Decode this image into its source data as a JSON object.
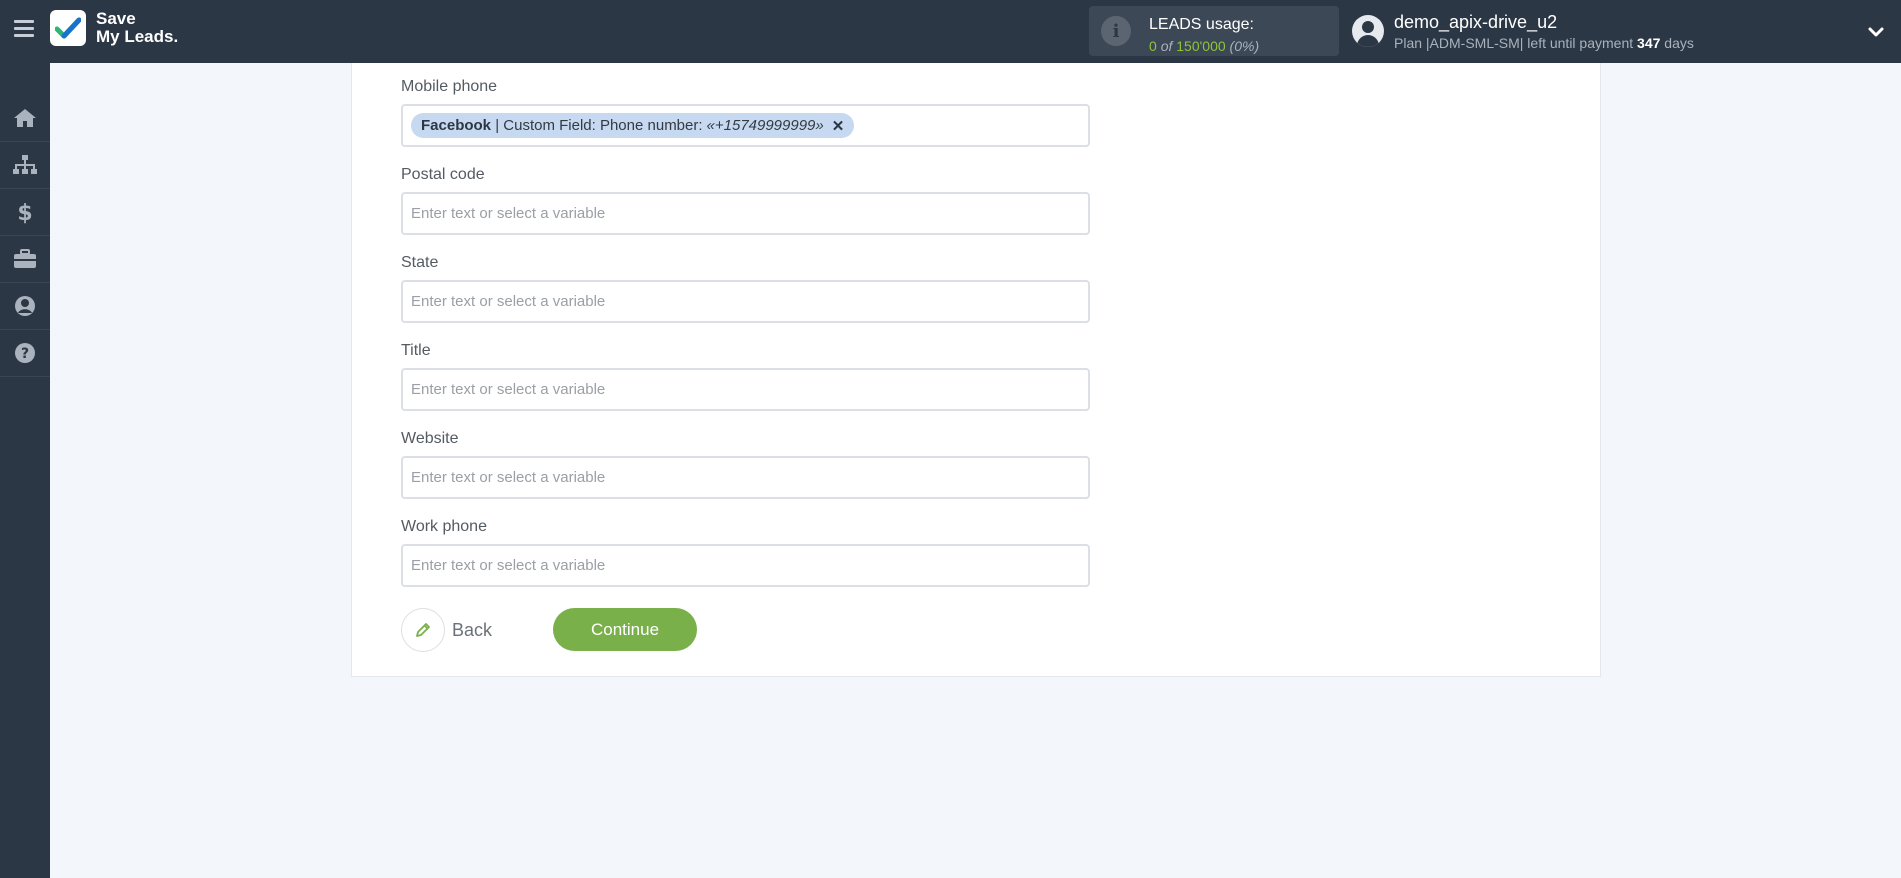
{
  "header": {
    "logo_line1": "Save",
    "logo_line2": "My Leads.",
    "usage": {
      "title": "LEADS usage:",
      "used": "0",
      "of": "of",
      "total": "150'000",
      "percent": "(0%)"
    },
    "user": {
      "name": "demo_apix-drive_u2",
      "plan_prefix": "Plan |ADM-SML-SM| left until payment",
      "days": "347",
      "days_suffix": "days"
    }
  },
  "sidebar": {
    "items": [
      {
        "icon": "home-icon"
      },
      {
        "icon": "sitemap-icon"
      },
      {
        "icon": "dollar-icon"
      },
      {
        "icon": "briefcase-icon"
      },
      {
        "icon": "user-circle-icon"
      },
      {
        "icon": "question-circle-icon"
      }
    ]
  },
  "form": {
    "mobile_phone": {
      "label": "Mobile phone",
      "tag_source": "Facebook",
      "tag_field": "| Custom Field: Phone number:",
      "tag_value": "«+15749999999»"
    },
    "postal_code": {
      "label": "Postal code",
      "placeholder": "Enter text or select a variable"
    },
    "state": {
      "label": "State",
      "placeholder": "Enter text or select a variable"
    },
    "title": {
      "label": "Title",
      "placeholder": "Enter text or select a variable"
    },
    "website": {
      "label": "Website",
      "placeholder": "Enter text or select a variable"
    },
    "work_phone": {
      "label": "Work phone",
      "placeholder": "Enter text or select a variable"
    },
    "back_label": "Back",
    "continue_label": "Continue"
  },
  "colors": {
    "topbar": "#2c3745",
    "accent_green": "#7ab04a",
    "tag_bg": "#c6d9f1",
    "page_bg": "#f3f6fa"
  }
}
